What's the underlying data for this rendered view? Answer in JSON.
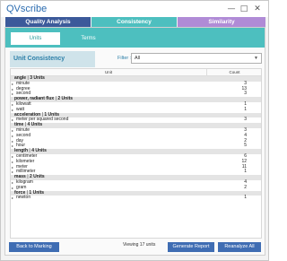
{
  "app": {
    "title": "QVscribe"
  },
  "main_tabs": [
    {
      "label": "Quality Analysis",
      "color": "#3c5a9a"
    },
    {
      "label": "Consistency",
      "color": "#4dbfbf"
    },
    {
      "label": "Similarity",
      "color": "#b08bd6"
    }
  ],
  "sub_tabs": [
    {
      "label": "Units"
    },
    {
      "label": "Terms"
    }
  ],
  "panel": {
    "title": "Unit Consistency",
    "filter_label": "Filter :",
    "filter_value": "All"
  },
  "grid": {
    "col_unit": "Unit",
    "col_count": "Count",
    "groups": [
      {
        "name": "angle",
        "count_label": "3 Units",
        "items": [
          {
            "unit": "minute",
            "count": "3"
          },
          {
            "unit": "degree",
            "count": "13"
          },
          {
            "unit": "second",
            "count": "3"
          }
        ]
      },
      {
        "name": "power, radiant flux",
        "count_label": "2 Units",
        "items": [
          {
            "unit": "kilowatt",
            "count": "1"
          },
          {
            "unit": "watt",
            "count": "1"
          }
        ]
      },
      {
        "name": "acceleration",
        "count_label": "1 Units",
        "items": [
          {
            "unit": "meter per squared second",
            "count": "3"
          }
        ]
      },
      {
        "name": "time",
        "count_label": "4 Units",
        "items": [
          {
            "unit": "minute",
            "count": "3"
          },
          {
            "unit": "second",
            "count": "4"
          },
          {
            "unit": "day",
            "count": "2"
          },
          {
            "unit": "hour",
            "count": "5"
          }
        ]
      },
      {
        "name": "length",
        "count_label": "4 Units",
        "items": [
          {
            "unit": "centimeter",
            "count": "6"
          },
          {
            "unit": "kilometer",
            "count": "12"
          },
          {
            "unit": "meter",
            "count": "11"
          },
          {
            "unit": "millimeter",
            "count": "1"
          }
        ]
      },
      {
        "name": "mass",
        "count_label": "2 Units",
        "items": [
          {
            "unit": "kilogram",
            "count": "4"
          },
          {
            "unit": "gram",
            "count": "2"
          }
        ]
      },
      {
        "name": "force",
        "count_label": "1 Units",
        "items": [
          {
            "unit": "newton",
            "count": "1"
          }
        ]
      }
    ]
  },
  "footer": {
    "back_label": "Back to Marking",
    "viewing_text": "Viewing 17 units",
    "report_label": "Generate Report",
    "reanalyze_label": "Reanalyze All"
  },
  "icons": {
    "minimize": "minimize-icon",
    "maximize": "maximize-icon",
    "close": "close-icon",
    "dropdown": "chevron-down-icon",
    "row_expand": "caret-right-icon"
  }
}
